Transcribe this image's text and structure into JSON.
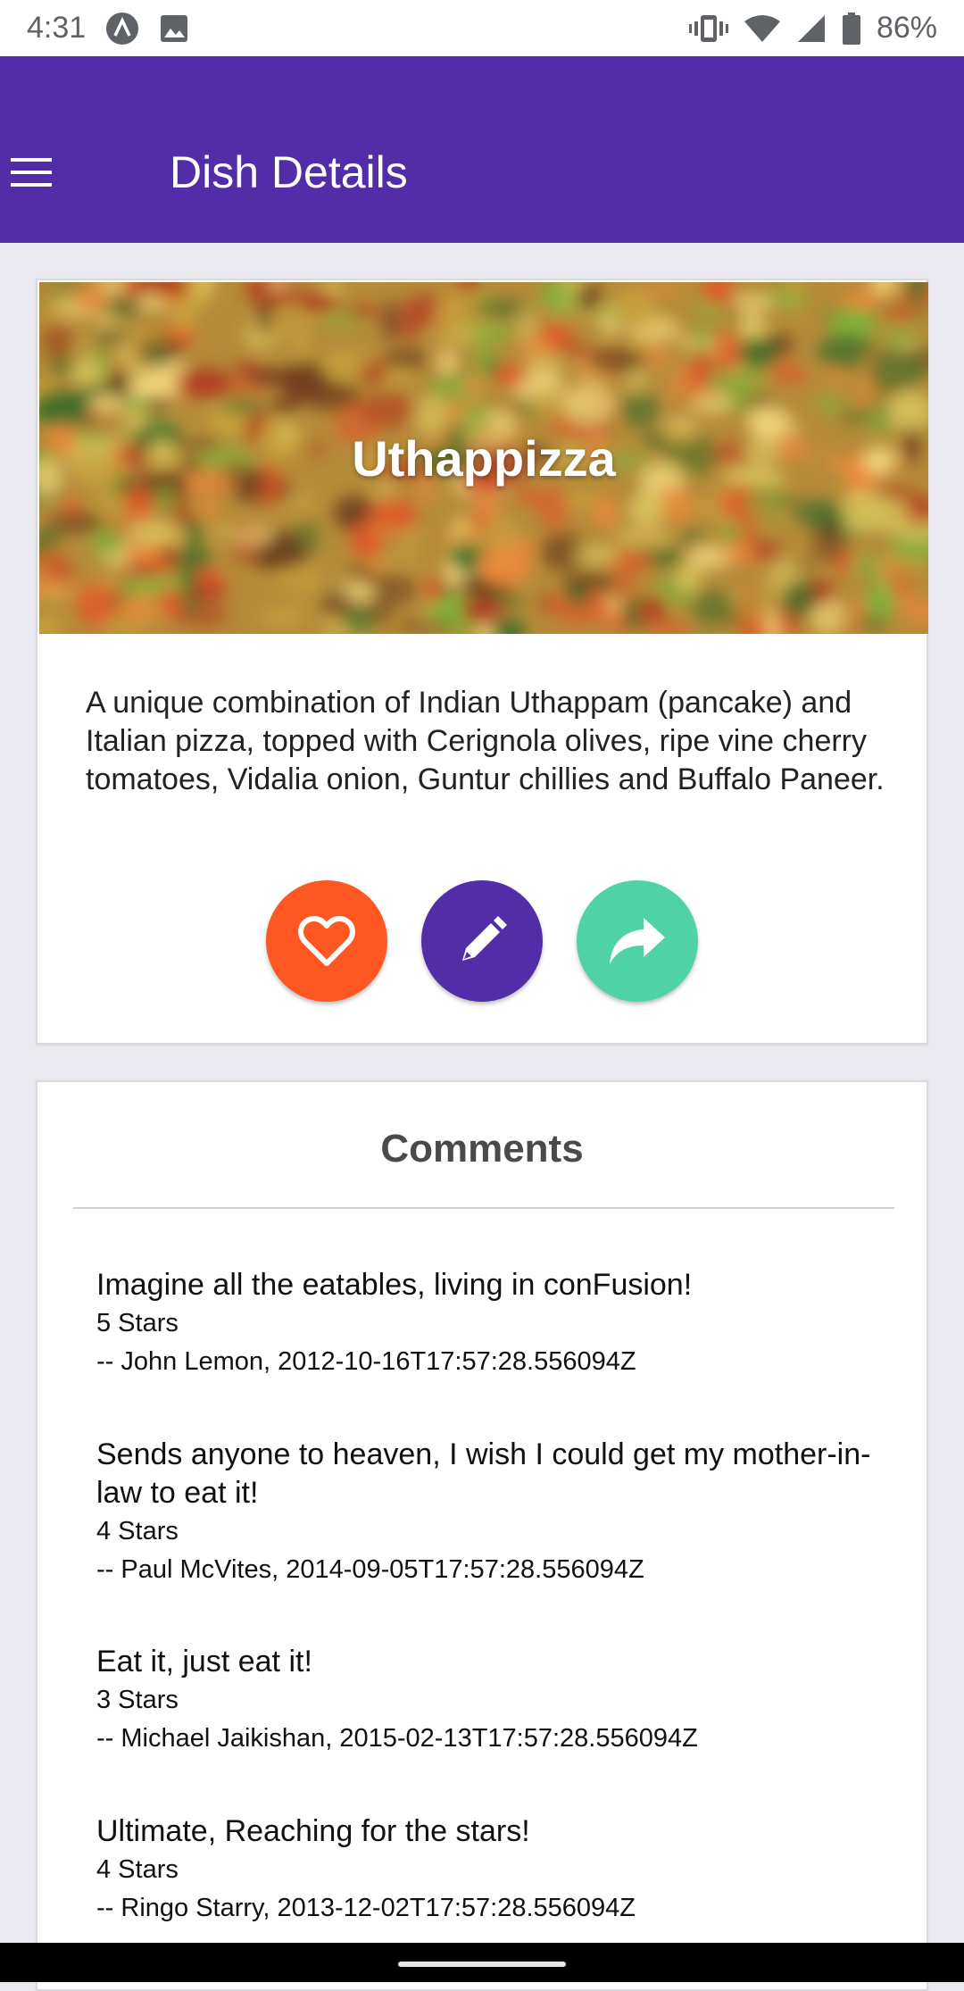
{
  "status_bar": {
    "time": "4:31",
    "battery": "86%",
    "icons": [
      "app-notification-icon",
      "image-notification-icon",
      "vibrate-icon",
      "wifi-icon",
      "signal-icon",
      "battery-icon"
    ]
  },
  "app_bar": {
    "title": "Dish Details",
    "menu_icon": "hamburger-menu-icon",
    "color": "#512da8"
  },
  "dish": {
    "name": "Uthappizza",
    "description": "A unique combination of Indian Uthappam (pancake) and Italian pizza, topped with Cerignola olives, ripe vine cherry tomatoes, Vidalia onion, Guntur chillies and Buffalo Paneer.",
    "actions": [
      {
        "icon": "heart-outline-icon",
        "color": "#ff5722"
      },
      {
        "icon": "pencil-icon",
        "color": "#512da8"
      },
      {
        "icon": "share-icon",
        "color": "#4fd3a6"
      }
    ]
  },
  "comments": {
    "title": "Comments",
    "items": [
      {
        "text": "Imagine all the eatables, living in conFusion!",
        "rating": "5 Stars",
        "author": "-- John Lemon, 2012-10-16T17:57:28.556094Z"
      },
      {
        "text": "Sends anyone to heaven, I wish I could get my mother-in-law to eat it!",
        "rating": "4 Stars",
        "author": "-- Paul McVites, 2014-09-05T17:57:28.556094Z"
      },
      {
        "text": "Eat it, just eat it!",
        "rating": "3 Stars",
        "author": "-- Michael Jaikishan, 2015-02-13T17:57:28.556094Z"
      },
      {
        "text": "Ultimate, Reaching for the stars!",
        "rating": "4 Stars",
        "author": "-- Ringo Starry, 2013-12-02T17:57:28.556094Z"
      }
    ]
  }
}
